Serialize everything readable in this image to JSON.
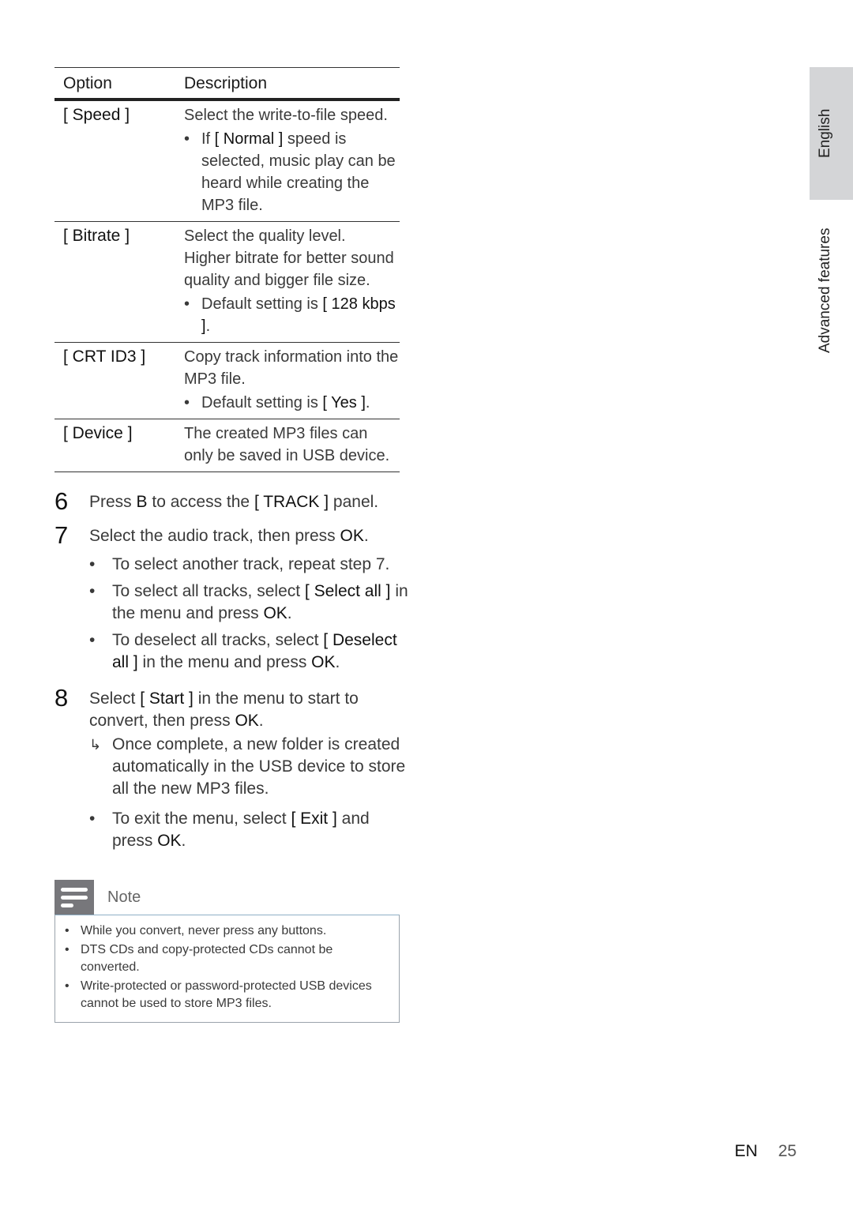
{
  "table": {
    "headers": {
      "option": "Option",
      "description": "Description"
    },
    "rows": [
      {
        "option": "[ Speed ]",
        "lines": [
          "Select the write-to-file speed."
        ],
        "bullet": {
          "pre": "If ",
          "em": "[ Normal ]",
          "post": " speed is selected, music play can be heard while creating the MP3 file."
        }
      },
      {
        "option": "[ Bitrate ]",
        "lines": [
          "Select the quality level.",
          "Higher bitrate for better sound quality and bigger file size."
        ],
        "bullet": {
          "pre": "Default setting is ",
          "em": "[ 128 kbps ]",
          "post": "."
        }
      },
      {
        "option": "[ CRT ID3 ]",
        "lines": [
          "Copy track information into the MP3 file."
        ],
        "bullet": {
          "pre": "Default setting is ",
          "em": "[ Yes ]",
          "post": "."
        }
      },
      {
        "option": "[ Device ]",
        "lines": [
          "The created MP3 files can only be saved in USB device."
        ],
        "bullet": null
      }
    ]
  },
  "steps": {
    "s6": {
      "num": "6",
      "t1": "Press ",
      "key": "B",
      "t2": " to access the ",
      "em": "[ TRACK ]",
      "t3": " panel."
    },
    "s7": {
      "num": "7",
      "t1": "Select the audio track, then press ",
      "em": "OK",
      "t2": ".",
      "subs": [
        {
          "t1": "To select another track, repeat step 7."
        },
        {
          "t1": "To select all tracks, select ",
          "em": "[ Select all ]",
          "t2": " in the menu and press ",
          "em2": "OK",
          "t3": "."
        },
        {
          "t1": "To deselect all tracks, select ",
          "em": "[ Deselect all ]",
          "t2": " in the menu and press ",
          "em2": "OK",
          "t3": "."
        }
      ]
    },
    "s8": {
      "num": "8",
      "t1": "Select ",
      "em": "[ Start ]",
      "t2": " in the menu to start to convert, then press ",
      "em2": "OK",
      "t3": ".",
      "result": "Once complete, a new folder is created automatically in the USB device to store all the new MP3 files.",
      "sub": {
        "t1": "To exit the menu, select ",
        "em": "[ Exit ]",
        "t2": " and press ",
        "em2": "OK",
        "t3": "."
      }
    }
  },
  "note": {
    "title": "Note",
    "icon": "note-lines-icon",
    "items": [
      "While you convert, never press any buttons.",
      "DTS CDs and copy-protected CDs cannot be converted.",
      "Write-protected or password-protected USB devices cannot be used to store MP3 files."
    ]
  },
  "side": {
    "language": "English",
    "section": "Advanced features"
  },
  "footer": {
    "lang": "EN",
    "page": "25"
  },
  "glyphs": {
    "bullet": "•",
    "arrow": "↳"
  }
}
